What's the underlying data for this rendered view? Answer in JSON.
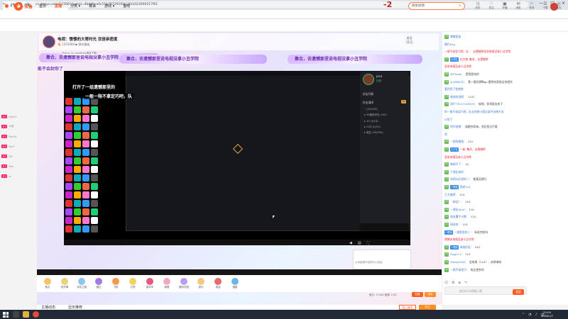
{
  "browser": {
    "tab_title": "斗鱼直播_电视直播_电视剧场_斗鱼",
    "close_glyph": "×",
    "new_tab": "+",
    "url": "cn.douyu.com/12306?dyshid=4bd4f-ca0c51b797291f0dc2fe1023000217f01",
    "nav": [
      "←",
      "→",
      "⟳",
      "⌂"
    ],
    "window_controls": [
      "—",
      "□",
      "×"
    ]
  },
  "page_counter": "-2",
  "site": {
    "logo_text": "斗鱼",
    "nav": [
      "首页",
      "直播",
      "分类 ▾",
      "赛事",
      "游戏 ▾",
      "鱼吧"
    ],
    "active_nav": 1,
    "search_placeholder": "搜索剧情",
    "search_icon": "magnifier-icon",
    "header_icons": [
      {
        "glyph": "◷",
        "label": "历史"
      },
      {
        "glyph": "♡",
        "label": "关注"
      },
      {
        "glyph": "▣",
        "label": "开播"
      },
      {
        "glyph": "✉",
        "label": "消息"
      },
      {
        "glyph": "⚐",
        "label": "任务"
      },
      {
        "glyph": "☰",
        "label": "下载"
      },
      {
        "glyph": "◎",
        "label": "鱼丸"
      }
    ]
  },
  "stream": {
    "title": "电视：憬憬的大哥时光 双倍亲密度",
    "sub": "🔥 1351464  ▶ 斜杠圈友",
    "follow": [
      "关注",
      "11万"
    ],
    "game_label": "Plants Vs Zombies(精品下载)",
    "banners": [
      "集合，去遗憾那里说电视没拿小丑学院",
      "集合，去遗憾那里说电视没拿小丑学院",
      "集合，去遗憾那里说电视没拿小丑学院"
    ],
    "warn1": "能不会封你了",
    "warn2": "打开了一组遗憾那里的",
    "warn3": "一般一限不拿定巧吧，队",
    "taskbar_label": "已连接"
  },
  "friend_panel": {
    "name": "pico",
    "status": "在线",
    "friends_label": "好友列表",
    "request_label": "好友请求",
    "request_count": "26",
    "groups": [
      "◦ (22/103)",
      "▸ 99微信好友 (4/5)",
      "▸ 10 (3/14)",
      "▸ CGR (0/13)",
      "▸ 陌生 (55/555)"
    ]
  },
  "popup": {
    "text": "从电脑操作控制中心发起"
  },
  "gifts": [
    {
      "label": "鱼丸",
      "color": "#f7c36b"
    },
    {
      "label": "荧光棒",
      "color": "#e7d37c"
    },
    {
      "label": "冰化之路",
      "color": "#8ec5f1"
    },
    {
      "label": "猫比",
      "color": "#a37be6"
    },
    {
      "label": "飞机",
      "color": "#f49a4a"
    },
    {
      "label": "灯饰",
      "color": "#f3d25a"
    },
    {
      "label": "嘉年华",
      "color": "#e6597a"
    },
    {
      "label": "阁楼",
      "color": "#f7a7c4"
    },
    {
      "label": "福利花园",
      "color": "#b99df0"
    },
    {
      "label": "纸巾",
      "color": "#f5c97f"
    },
    {
      "label": "电话",
      "color": "#e46c6c"
    },
    {
      "label": "福星",
      "color": "#6fb4e8"
    }
  ],
  "gift_info": "鱼丸: 17444   鱼翅: 2.45",
  "gift_buttons": [
    "充值",
    "背包"
  ],
  "below_tabs": [
    "主播动态",
    "剪天推荐"
  ],
  "below_buttons": [
    "进入鱼吧",
    "关注"
  ],
  "left_feed": [
    {
      "badge": "天才",
      "text": "Hyp11"
    },
    {
      "badge": "天才",
      "text": "斗鱼"
    },
    {
      "badge": "天才",
      "text": "Shn10"
    },
    {
      "badge": "天才",
      "text": "FanT"
    },
    {
      "badge": "天才",
      "text": "Sni"
    },
    {
      "badge": "天才",
      "text": "Shn"
    },
    {
      "badge": "天才",
      "text": "ai"
    }
  ],
  "chat": [
    {
      "lvl": "29",
      "fan": "",
      "user": "嫦娥家族",
      "msg": ""
    },
    {
      "lvl": "",
      "fan": "",
      "user": "悬朽Eng",
      "msg": ""
    },
    {
      "lvl": "",
      "fan": "",
      "user": "一限不拿定巧吧，队：",
      "msg": "去遗憾那里说电视没拿小丑学院",
      "red": true
    },
    {
      "lvl": "17",
      "fan": "小学生",
      "user": "红白格",
      "msg": "集合，去遗憾那",
      "red": true
    },
    {
      "lvl": "",
      "fan": "",
      "user": "里说电视没拿小丑学院",
      "msg": "",
      "red": true
    },
    {
      "lvl": "18",
      "fan": "",
      "user": "MS7pwk：",
      "msg": "是我是电的"
    },
    {
      "lvl": "16",
      "fan": "",
      "user": "yu298225：",
      "msg": "我一限奶狮啊go 看到吃豪餐女你就先"
    },
    {
      "lvl": "",
      "fan": "",
      "user": "看到到了我就想",
      "msg": ""
    },
    {
      "lvl": "13",
      "fan": "",
      "user": "痕迹的说图：",
      "msg": "1147"
    },
    {
      "lvl": "13",
      "fan": "",
      "user": "用户72017145529：",
      "msg": "唉呢，你再限去给下"
    },
    {
      "lvl": "",
      "fan": "",
      "user": "你一般不拿定巧吧，队去说做小丽比拿不去做不去",
      "msg": ""
    },
    {
      "lvl": "",
      "fan": "",
      "user": "计划了",
      "msg": ""
    },
    {
      "lvl": "15",
      "fan": "",
      "user": "阿尔拍图：",
      "msg": "请跟你再来，到后我记不要"
    },
    {
      "lvl": "",
      "fan": "",
      "user": "到",
      "msg": ""
    },
    {
      "lvl": "14",
      "fan": "",
      "user": "一限找蜜我：",
      "msg": "114"
    },
    {
      "lvl": "11",
      "fan": "三个字",
      "user": "一级",
      "msg": "集合，去遗憾那",
      "red": true
    },
    {
      "lvl": "",
      "fan": "",
      "user": "里说电视没拿小丑学院",
      "msg": "",
      "red": true
    },
    {
      "lvl": "11",
      "fan": "",
      "user": "神秘不了：",
      "msg": "14"
    },
    {
      "lvl": "11",
      "fan": "",
      "user": "少我比较好：",
      "msg": ""
    },
    {
      "lvl": "13",
      "fan": "",
      "user": "电视以后说的二：",
      "msg": "能真没就行"
    },
    {
      "lvl": "12",
      "fan": "一限钱",
      "user": "我说114",
      "msg": ""
    },
    {
      "lvl": "",
      "fan": "",
      "user": "王大咖吧：",
      "msg": "114"
    },
    {
      "lvl": "15",
      "fan": "",
      "user": "（淘宝）：",
      "msg": "114"
    },
    {
      "lvl": "12",
      "fan": "",
      "user": "一限花(bro)：",
      "msg": "114"
    },
    {
      "lvl": "11",
      "fan": "",
      "user": "网友最牛大狮：",
      "msg": "114"
    },
    {
      "lvl": "11",
      "fan": "",
      "user": "网说的：",
      "msg": "114"
    },
    {
      "lvl": "",
      "fan": "一限钱",
      "user": "一限那里的二：",
      "msg": "有说完的吗"
    },
    {
      "lvl": "",
      "fan": "",
      "user": "遗憾去电视没拿小丑学院",
      "msg": "",
      "red": true
    },
    {
      "lvl": "12",
      "fan": "一限钱",
      "user": "网络好友：",
      "msg": "145"
    },
    {
      "lvl": "13",
      "fan": "",
      "user": "Flgg111：",
      "msg": "114"
    },
    {
      "lvl": "11",
      "fan": "",
      "user": "Sheep2Oef：",
      "msg": "会电视（114）：迪讲咖啡"
    },
    {
      "lvl": "12",
      "fan": "",
      "user": "一限不拿定巧：",
      "msg": "有比更多的"
    }
  ],
  "chat_input_placeholder": "说点什么吧输入吧",
  "chat_send": "发送",
  "chat_icons": [
    "☺",
    "✿",
    "◈",
    "✎"
  ],
  "taskbar": {
    "time": "22:05",
    "date": "2026/1/7",
    "tray": [
      "⌃",
      "◔",
      "♪",
      "中"
    ]
  }
}
